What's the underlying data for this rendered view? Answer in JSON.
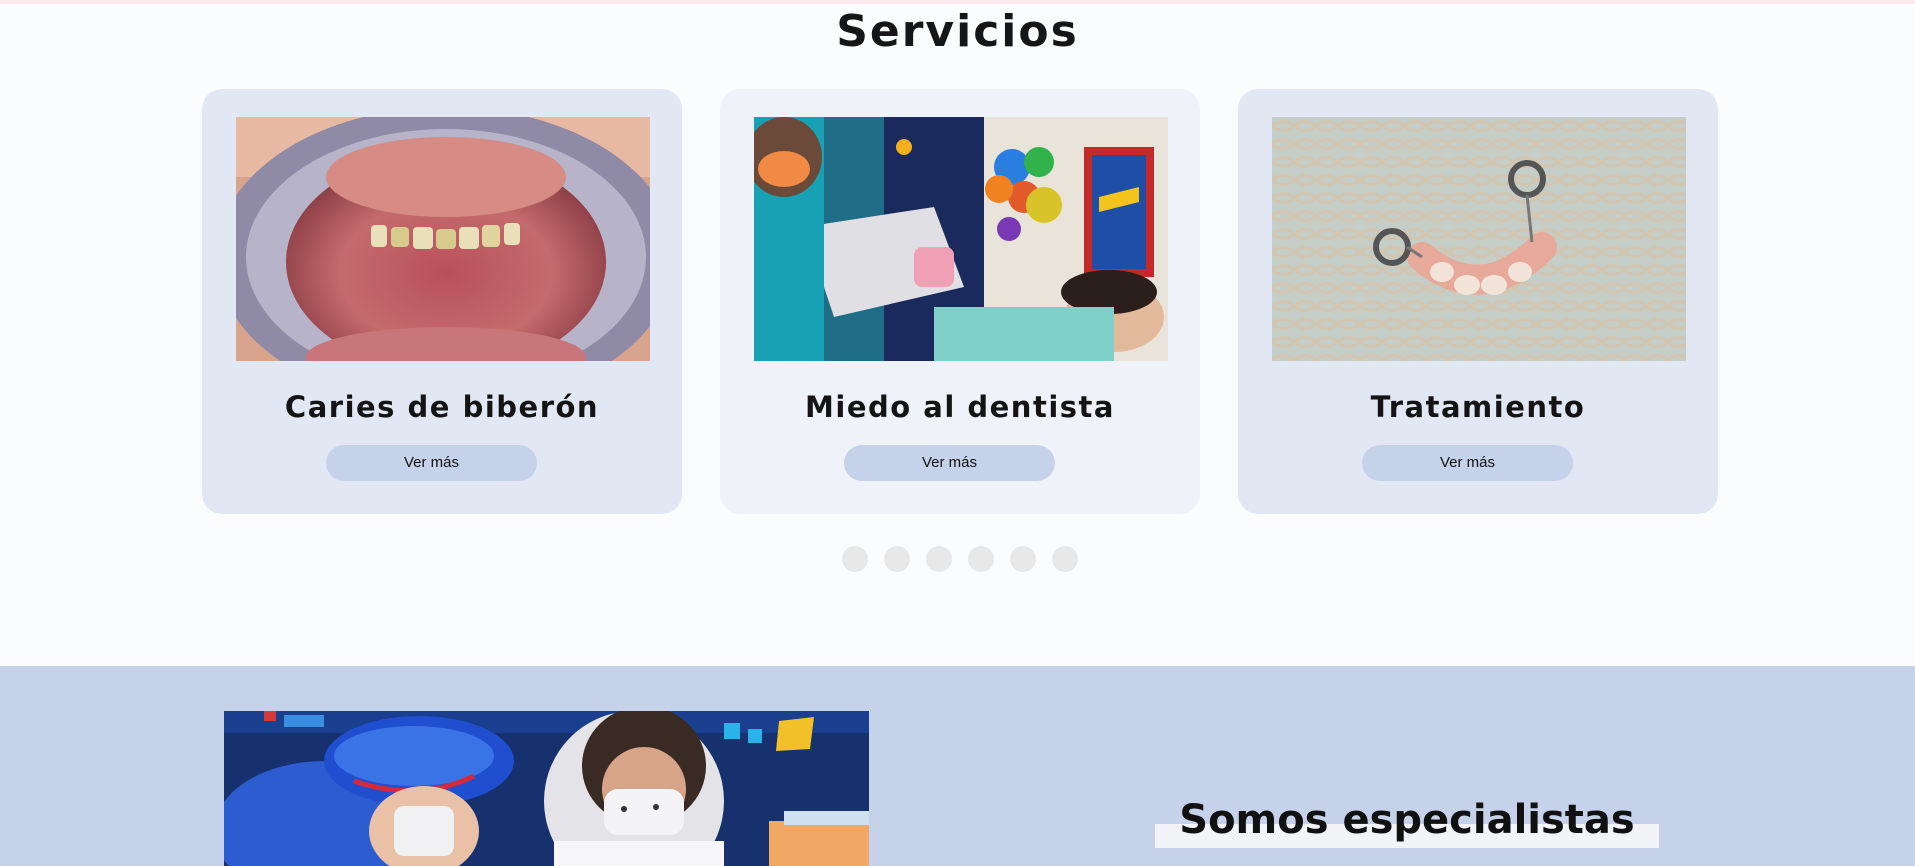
{
  "services": {
    "title": "Servicios",
    "cards": [
      {
        "title": "Caries de biberón",
        "button_label": "Ver más",
        "image": "open-mouth-baby-bottle-caries-photo"
      },
      {
        "title": "Miedo al dentista",
        "button_label": "Ver más",
        "image": "child-dental-xray-space-room-photo"
      },
      {
        "title": "Tratamiento",
        "button_label": "Ver más",
        "image": "pediatric-dental-appliance-on-net-photo"
      }
    ],
    "carousel": {
      "dot_count": 6,
      "active_index": 0
    }
  },
  "about": {
    "title": "Somos especialistas",
    "image": "dentist-with-child-patient-photo"
  },
  "colors": {
    "page_bg": "#fbfcfe",
    "card_bg": "#e1e7f3",
    "card_bg_alt": "#eff3f9",
    "button_bg": "#c6d2e9",
    "section_bg": "#c6d2e9",
    "dot": "#e8e8e8"
  }
}
